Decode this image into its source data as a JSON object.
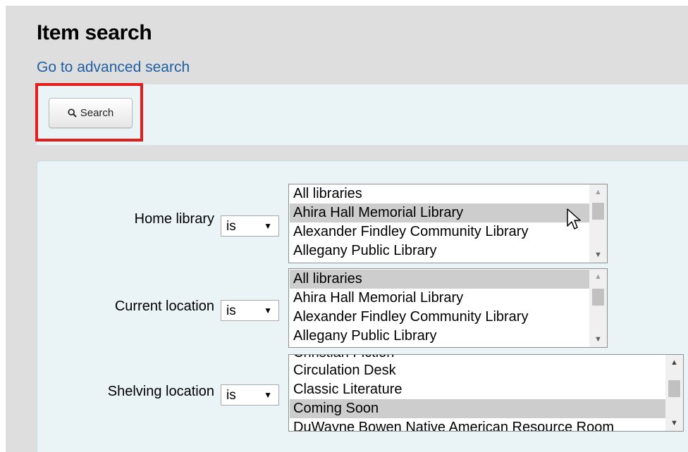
{
  "page": {
    "title": "Item search",
    "advanced_link": "Go to advanced search"
  },
  "toolbar": {
    "search_label": "Search",
    "search_icon": "search-icon"
  },
  "fields": {
    "home_library": {
      "label": "Home library",
      "operator": "is",
      "options": [
        "All libraries",
        "Ahira Hall Memorial Library",
        "Alexander Findley Community Library",
        "Allegany Public Library"
      ],
      "highlighted": "Ahira Hall Memorial Library"
    },
    "current_location": {
      "label": "Current location",
      "operator": "is",
      "options": [
        "All libraries",
        "Ahira Hall Memorial Library",
        "Alexander Findley Community Library",
        "Allegany Public Library"
      ],
      "selected": "All libraries"
    },
    "shelving_location": {
      "label": "Shelving location",
      "operator": "is",
      "options": [
        "Christian Fiction",
        "Circulation Desk",
        "Classic Literature",
        "Coming Soon",
        "DuWayne Bowen Native American Resource Room"
      ],
      "selected": "Coming Soon"
    }
  },
  "colors": {
    "highlight_border": "#e41c1c",
    "link": "#1f5fa3",
    "panel_background": "#eaf4f7",
    "page_background": "#dedede"
  }
}
